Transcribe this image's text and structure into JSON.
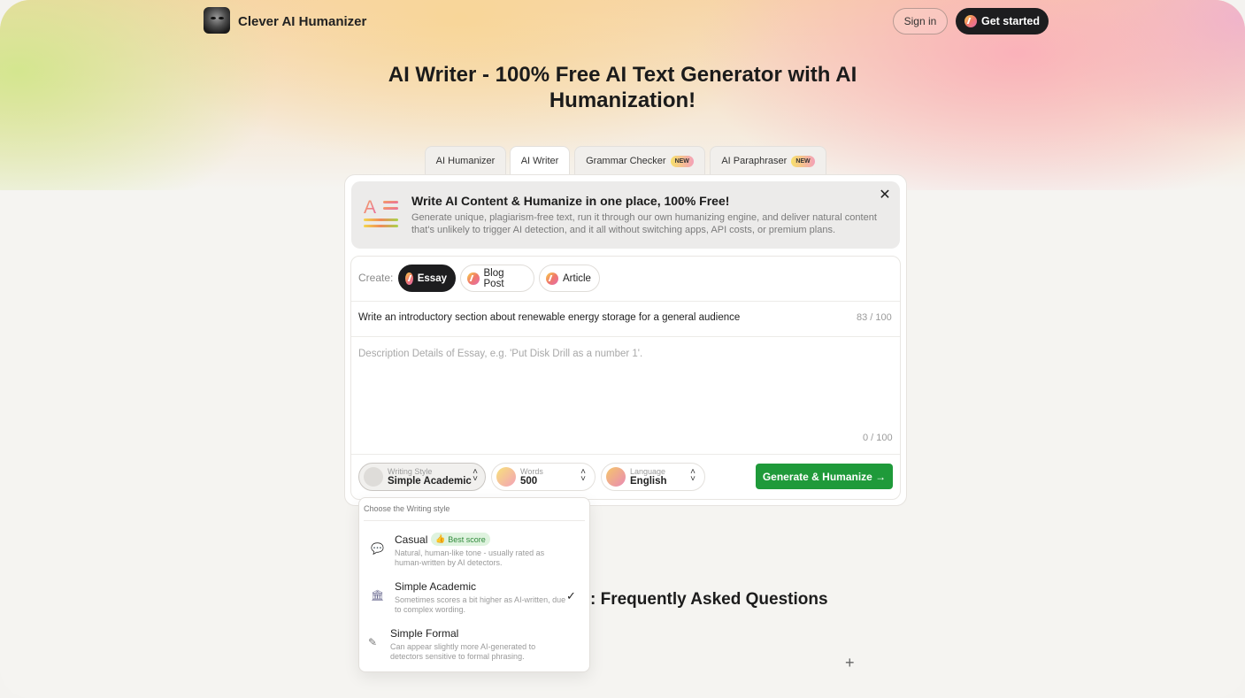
{
  "header": {
    "brand": "Clever AI Humanizer",
    "sign_in": "Sign in",
    "get_started": "Get started"
  },
  "page_title": "AI Writer - 100% Free AI Text Generator with AI Humanization!",
  "tabs": [
    {
      "label": "AI Humanizer",
      "badge": "",
      "active": false
    },
    {
      "label": "AI Writer",
      "badge": "",
      "active": true
    },
    {
      "label": "Grammar Checker",
      "badge": "NEW",
      "active": false
    },
    {
      "label": "AI Paraphraser",
      "badge": "NEW",
      "active": false
    }
  ],
  "promo": {
    "title": "Write AI Content & Humanize in one place, 100% Free!",
    "text": "Generate unique, plagiarism-free text, run it through our own humanizing engine, and deliver natural content that's unlikely to trigger AI detection, and it all without switching apps, API costs, or premium plans.",
    "icon": "text-lines-icon"
  },
  "create": {
    "label": "Create:",
    "options": [
      {
        "label": "Essay",
        "active": true
      },
      {
        "label": "Blog Post",
        "active": false
      },
      {
        "label": "Article",
        "active": false
      }
    ]
  },
  "prompt": {
    "value": "Write an introductory section about renewable energy storage for a general audience",
    "counter": "83 / 100"
  },
  "description": {
    "placeholder": "Description Details of Essay, e.g. 'Put Disk Drill as a number 1'.",
    "counter": "0 / 100"
  },
  "controls": {
    "writing_style": {
      "caption": "Writing Style",
      "value": "Simple Academic"
    },
    "words": {
      "caption": "Words",
      "value": "500"
    },
    "language": {
      "caption": "Language",
      "value": "English"
    },
    "generate": "Generate & Humanize →"
  },
  "dropdown": {
    "heading": "Choose the Writing style",
    "options": [
      {
        "title": "Casual",
        "badge": "Best score",
        "desc": "Natural, human-like tone - usually rated as human-written by AI detectors.",
        "icon": "speech-bubble-icon",
        "selected": false
      },
      {
        "title": "Simple Academic",
        "badge": "",
        "desc": "Sometimes scores a bit higher as AI-written, due to complex wording.",
        "icon": "institution-icon",
        "selected": true
      },
      {
        "title": "Simple Formal",
        "badge": "",
        "desc": "Can appear slightly more AI-generated to detectors sensitive to formal phrasing.",
        "icon": "pen-icon",
        "selected": false
      }
    ]
  },
  "faq": {
    "title_fragment": ": Frequently Asked Questions",
    "expand": "+"
  },
  "colors": {
    "primary_dark": "#1d1d1f",
    "generate_green": "#1f9a3a",
    "best_score_bg": "#dff3df"
  }
}
